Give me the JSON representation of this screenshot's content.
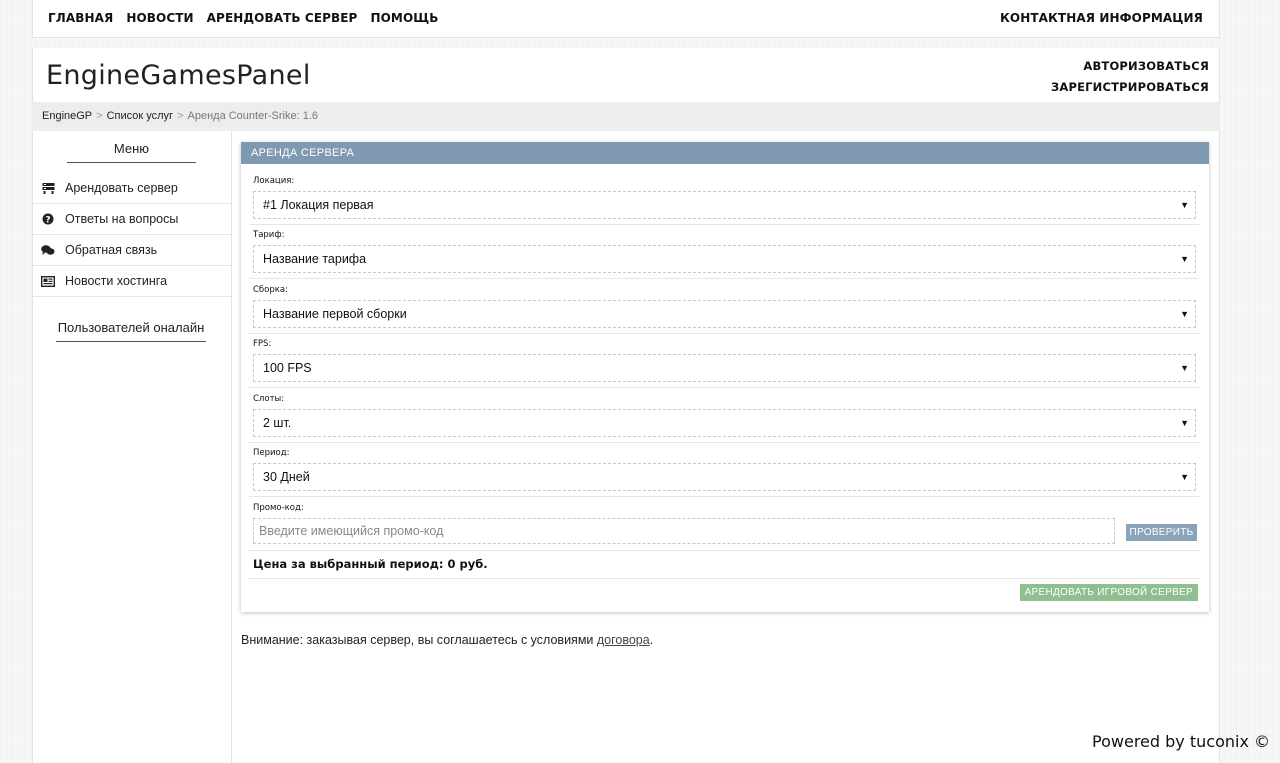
{
  "topnav": {
    "links": [
      "ГЛАВНАЯ",
      "НОВОСТИ",
      "АРЕНДОВАТЬ СЕРВЕР",
      "ПОМОЩЬ"
    ],
    "contact": "КОНТАКТНАЯ ИНФОРМАЦИЯ"
  },
  "header": {
    "logo": "EngineGamesPanel",
    "login": "АВТОРИЗОВАТЬСЯ",
    "register": "ЗАРЕГИСТРИРОВАТЬСЯ"
  },
  "breadcrumb": {
    "items": [
      "EngineGP",
      "Список услуг",
      "Аренда Counter-Srike: 1.6"
    ]
  },
  "sidebar": {
    "title": "Меню",
    "items": [
      {
        "label": "Арендовать сервер",
        "icon": "server-icon"
      },
      {
        "label": "Ответы на вопросы",
        "icon": "question-circle-icon"
      },
      {
        "label": "Обратная связь",
        "icon": "chat-bubbles-icon"
      },
      {
        "label": "Новости хостинга",
        "icon": "newspaper-icon"
      }
    ],
    "online_title": "Пользователей оналайн"
  },
  "panel": {
    "title": "АРЕНДА СЕРВЕРА",
    "fields": [
      {
        "label": "Локация:",
        "value": "#1 Локация первая"
      },
      {
        "label": "Тариф:",
        "value": "Название тарифа"
      },
      {
        "label": "Сборка:",
        "value": "Название первой сборки"
      },
      {
        "label": "FPS:",
        "value": "100 FPS"
      },
      {
        "label": "Слоты:",
        "value": "2 шт."
      },
      {
        "label": "Период:",
        "value": "30 Дней"
      }
    ],
    "promo": {
      "label": "Промо-код:",
      "placeholder": "Введите имеющийся промо-код",
      "button": "ПРОВЕРИТЬ"
    },
    "price_text": "Цена за выбранный период: 0 руб.",
    "rent_button": "АРЕНДОВАТЬ ИГРОВОЙ СЕРВЕР"
  },
  "notice": {
    "text": "Внимание: заказывая сервер, вы соглашаетесь с условиями ",
    "link": "договора",
    "suffix": "."
  },
  "footer": {
    "powered": "Powered by tuconix ©"
  },
  "colors": {
    "panel_header": "#7f99b1",
    "check_button": "#8aa3b8",
    "rent_button": "#8fbf8f"
  }
}
